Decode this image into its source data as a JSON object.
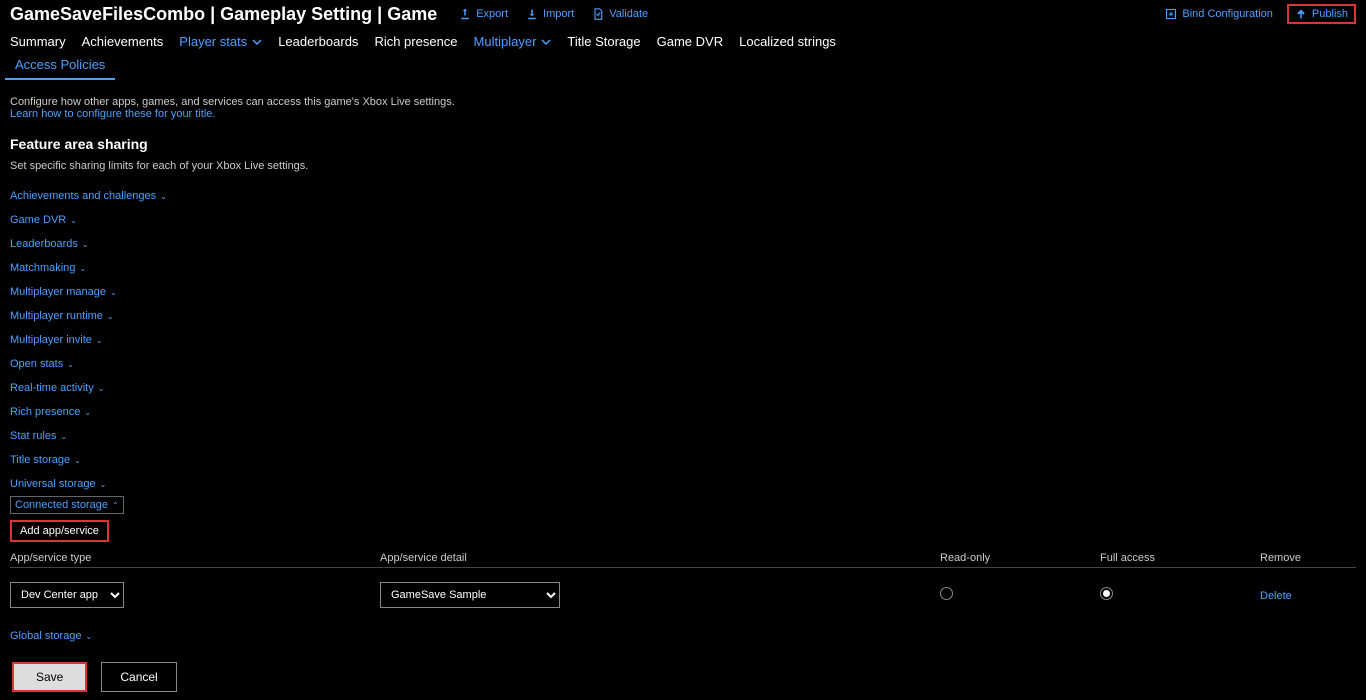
{
  "header": {
    "breadcrumb": "GameSaveFilesCombo | Gameplay Setting | Game",
    "export": "Export",
    "import": "Import",
    "validate": "Validate",
    "bind": "Bind Configuration",
    "publish": "Publish"
  },
  "nav": {
    "summary": "Summary",
    "achievements": "Achievements",
    "player_stats": "Player stats",
    "leaderboards": "Leaderboards",
    "rich_presence": "Rich presence",
    "multiplayer": "Multiplayer",
    "title_storage": "Title Storage",
    "game_dvr": "Game DVR",
    "localized": "Localized strings"
  },
  "subtab": "Access Policies",
  "page": {
    "desc": "Configure how other apps, games, and services can access this game's Xbox Live settings.",
    "learn": "Learn how to configure these for your title.",
    "section_title": "Feature area sharing",
    "section_desc": "Set specific sharing limits for each of your Xbox Live settings."
  },
  "features": [
    "Achievements and challenges",
    "Game DVR",
    "Leaderboards",
    "Matchmaking",
    "Multiplayer manage",
    "Multiplayer runtime",
    "Multiplayer invite",
    "Open stats",
    "Real-time activity",
    "Rich presence",
    "Stat rules",
    "Title storage",
    "Universal storage",
    "Connected storage"
  ],
  "add_service": "Add app/service",
  "table": {
    "col_type": "App/service type",
    "col_detail": "App/service detail",
    "col_ro": "Read-only",
    "col_fa": "Full access",
    "col_rm": "Remove",
    "row": {
      "type": "Dev Center app",
      "detail": "GameSave Sample",
      "delete": "Delete"
    }
  },
  "global_storage": "Global storage",
  "buttons": {
    "save": "Save",
    "cancel": "Cancel"
  }
}
